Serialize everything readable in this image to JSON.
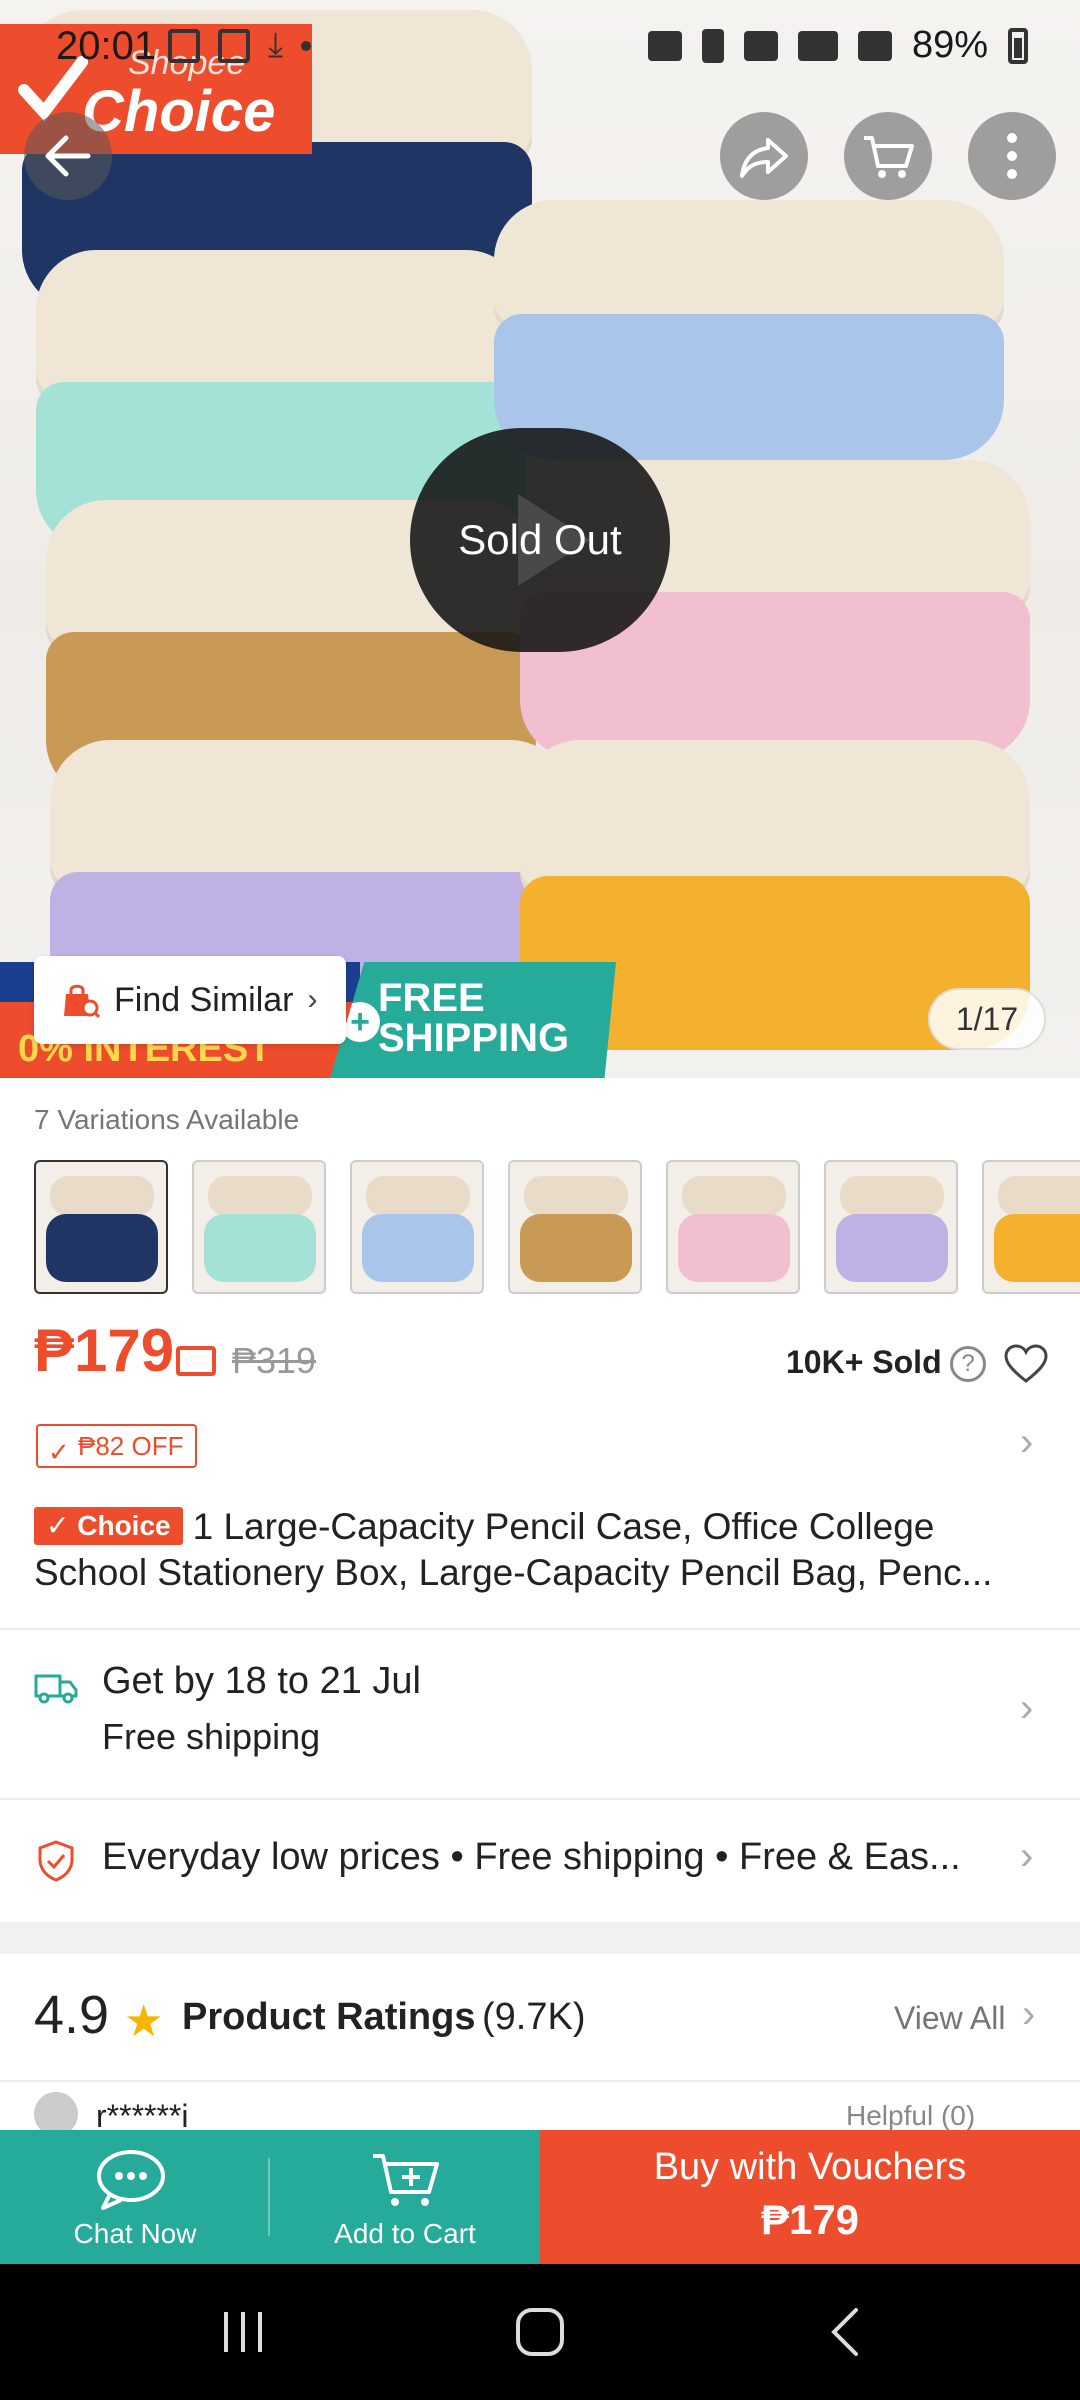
{
  "status_bar": {
    "time": "20:01",
    "battery": "89%"
  },
  "hero": {
    "brand_small": "Shopee",
    "brand_big": "Choice",
    "sold_out_label": "Sold Out",
    "find_similar_label": "Find Similar",
    "banner_left_text": "0% INTEREST",
    "banner_right_text_line1": "FREE",
    "banner_right_text_line2": "SHIPPING",
    "page_indicator": "1/17"
  },
  "variations": {
    "label": "7 Variations Available",
    "colors": [
      "#1f3564",
      "#a4e2d8",
      "#a9c6ea",
      "#c99a56",
      "#f2bfd0",
      "#bfb1e3",
      "#f3b12d"
    ]
  },
  "price": {
    "current": "₱179",
    "original": "₱319",
    "sold": "10K+ Sold",
    "help_glyph": "?"
  },
  "voucher": {
    "label": "₱82 OFF"
  },
  "product": {
    "badge": "Choice",
    "title": "1 Large-Capacity Pencil Case, Office College School Stationery Box, Large-Capacity Pencil Bag, Penc..."
  },
  "delivery": {
    "line1": "Get by 18 to 21 Jul",
    "line2": "Free shipping"
  },
  "guarantee": {
    "text": "Everyday low prices  •  Free shipping  •  Free & Eas..."
  },
  "ratings": {
    "score": "4.9",
    "title": "Product Ratings",
    "count": "(9.7K)",
    "view_all": "View All"
  },
  "review_peek": {
    "name": "r******i",
    "helpful": "Helpful (0)"
  },
  "bottom_bar": {
    "chat": "Chat Now",
    "add_to_cart": "Add to Cart",
    "buy_line1": "Buy with Vouchers",
    "buy_line2": "₱179"
  },
  "colors": {
    "brand_orange": "#ee4d2d",
    "brand_teal": "#26aa99"
  }
}
